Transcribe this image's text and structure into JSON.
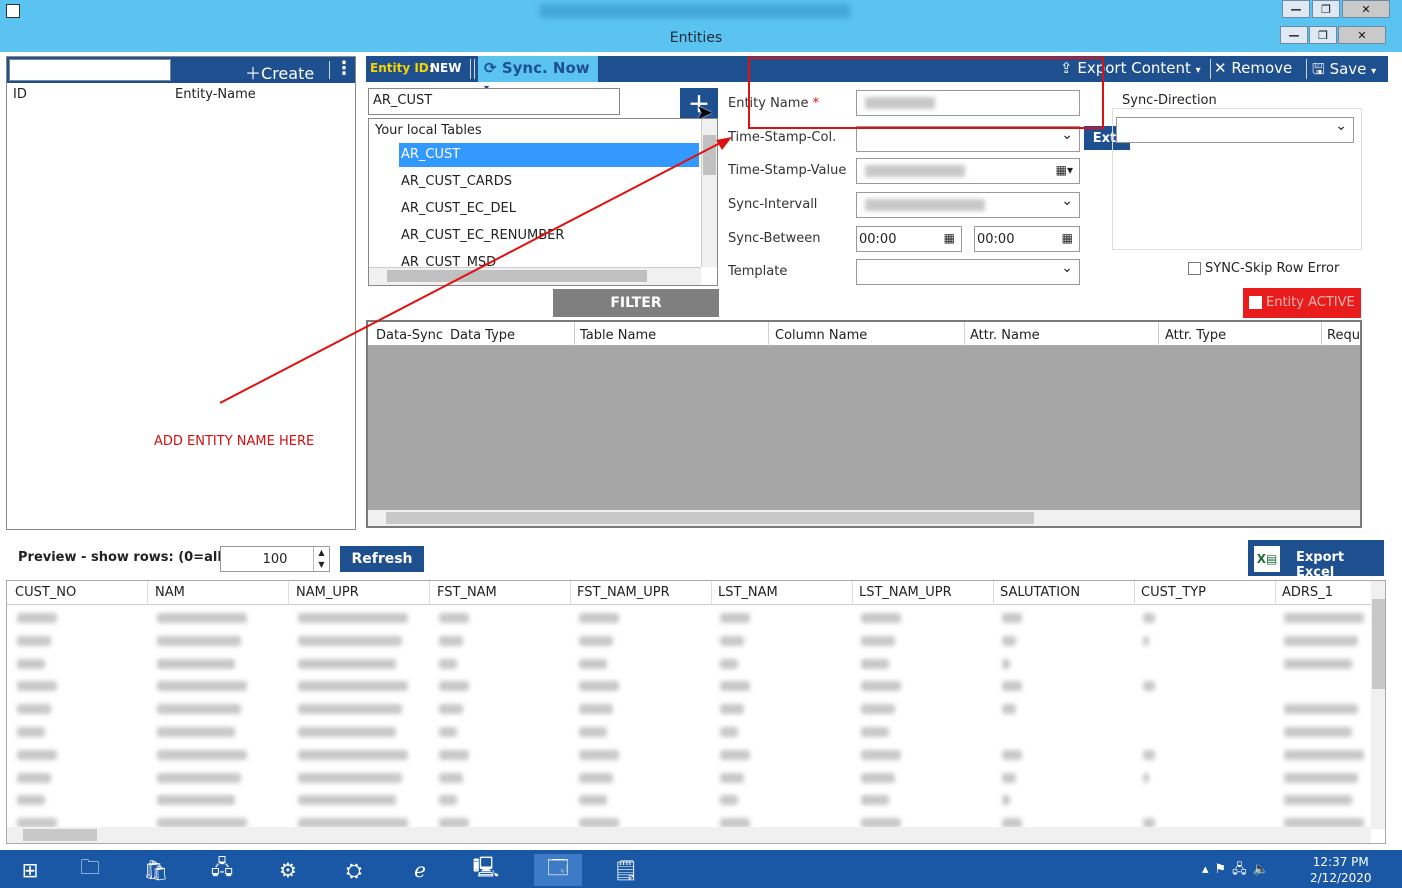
{
  "window": {
    "app_title": "Entities",
    "controls": [
      "—",
      "❐",
      "✕"
    ]
  },
  "left_panel": {
    "create_label": "Create",
    "columns": [
      "ID",
      "Entity-Name"
    ]
  },
  "toolbar": {
    "entity_id_label": "Entity ID:",
    "entity_id_value": "NEW",
    "sync_now_label": "Sync. Now",
    "export_content_label": "Export Content",
    "remove_label": "Remove",
    "save_label": "Save"
  },
  "table_selector": {
    "value": "AR_CUST",
    "list_header": "Your local Tables",
    "items": [
      "AR_CUST",
      "AR_CUST_CARDS",
      "AR_CUST_EC_DEL",
      "AR_CUST_EC_RENUMBER",
      "AR_CUST_MSD"
    ],
    "selected_index": 0,
    "filter_label": "FILTER"
  },
  "form": {
    "entity_name_label": "Entity Name",
    "required_mark": "*",
    "timestamp_col_label": "Time-Stamp-Col.",
    "timestamp_value_label": "Time-Stamp-Value",
    "sync_interval_label": "Sync-Intervall",
    "sync_between_label": "Sync-Between",
    "sync_between_from": "00:00",
    "sync_between_to": "00:00",
    "template_label": "Template",
    "ext_label": "Ext.",
    "sync_direction_label": "Sync-Direction",
    "skip_row_error_label": "SYNC-Skip Row Error",
    "entity_active_label": "Entity ACTIVE"
  },
  "attributes_grid": {
    "columns": [
      "Data-Sync",
      "Data Type",
      "Table Name",
      "Column Name",
      "Attr. Name",
      "Attr. Type",
      "Requ"
    ]
  },
  "annotation": {
    "text": "ADD ENTITY NAME HERE",
    "color": "#d01010"
  },
  "preview": {
    "label": "Preview - show rows: (0=all)",
    "rows_value": "100",
    "refresh_label": "Refresh",
    "export_excel_label": "Export Excel",
    "columns": [
      "CUST_NO",
      "NAM",
      "NAM_UPR",
      "FST_NAM",
      "FST_NAM_UPR",
      "LST_NAM",
      "LST_NAM_UPR",
      "SALUTATION",
      "CUST_TYP",
      "ADRS_1"
    ]
  },
  "taskbar": {
    "time": "12:37 PM",
    "date": "2/12/2020"
  },
  "colors": {
    "title_bar": "#5bc3ef",
    "toolbar": "#1e4f8f",
    "selection": "#3399ff",
    "entity_active": "#e81c1c"
  }
}
